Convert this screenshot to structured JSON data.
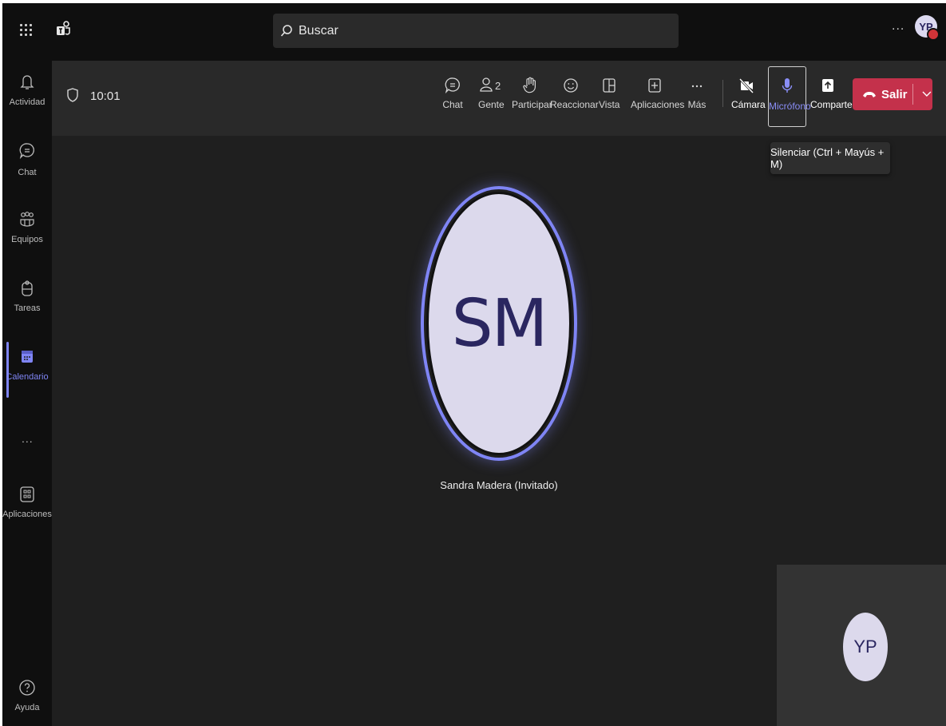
{
  "topbar": {
    "search_placeholder": "Buscar",
    "more": "...",
    "user_initials": "YP"
  },
  "rail": {
    "items": [
      {
        "label": "Actividad",
        "icon": "bell-icon"
      },
      {
        "label": "Chat",
        "icon": "chat-icon"
      },
      {
        "label": "Equipos",
        "icon": "teams-icon"
      },
      {
        "label": "Tareas",
        "icon": "tasks-icon"
      },
      {
        "label": "Calendario",
        "icon": "calendar-icon",
        "active": true
      },
      {
        "label": "Aplicaciones",
        "icon": "apps-icon"
      },
      {
        "label": "Ayuda",
        "icon": "help-icon"
      }
    ],
    "more": "..."
  },
  "meeting": {
    "timer": "10:01",
    "toolbar": {
      "chat": "Chat",
      "people": "Gente",
      "people_count": "2",
      "raise": "Participar",
      "react": "Reaccionar",
      "view": "Vista",
      "apps": "Aplicaciones",
      "more": "Más",
      "camera": "Cámara",
      "mic": "Micrófono",
      "share": "Comparte",
      "leave": "Salir"
    },
    "tooltip": "Silenciar (Ctrl + Mayús + M)",
    "participant": {
      "initials": "SM",
      "name": "Sandra Madera (Invitado)"
    },
    "self": {
      "initials": "YP"
    }
  },
  "colors": {
    "accent": "#7f85f5",
    "leave": "#c4314b",
    "background": "#1f1f1f"
  }
}
